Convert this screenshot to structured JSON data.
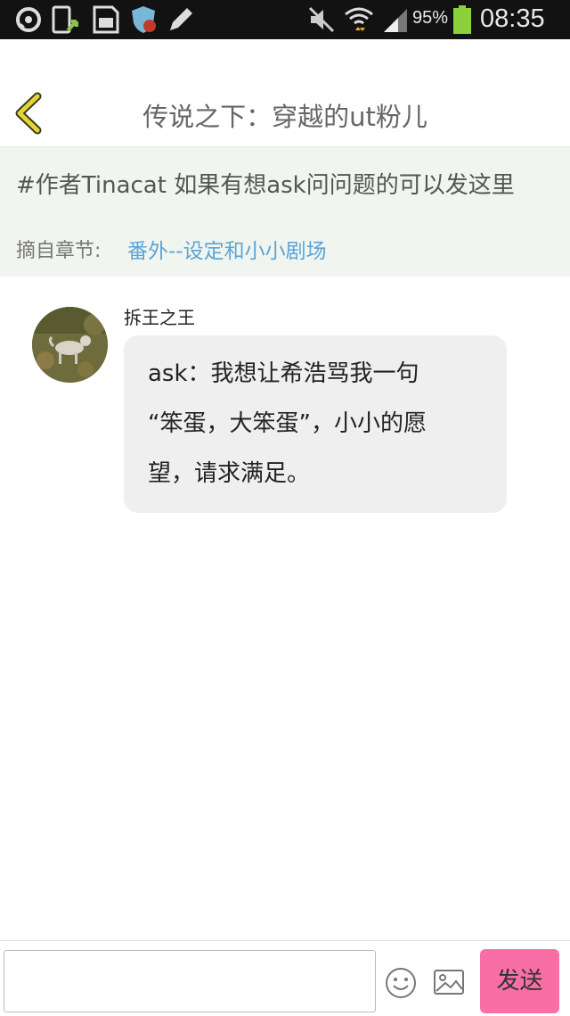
{
  "status_bar": {
    "battery_percent": "95%",
    "time": "08:35",
    "icons": [
      "chat-icon",
      "phone-sync-icon",
      "sd-card-icon",
      "shield-icon",
      "pencil-icon",
      "mute-icon",
      "wifi-icon",
      "signal-icon",
      "battery-icon"
    ]
  },
  "header": {
    "title": "传说之下：穿越的ut粉儿",
    "back_icon": "chevron-left-icon"
  },
  "topic": {
    "text": "#作者Tinacat 如果有想ask问问题的可以发这里",
    "chapter_label": "摘自章节:",
    "chapter_link": "番外--设定和小小剧场"
  },
  "message": {
    "username": "拆王之王",
    "lines": [
      "ask：我想让希浩骂我一句",
      "“笨蛋，大笨蛋”，小小的愿",
      "望，请求满足。"
    ]
  },
  "input_bar": {
    "placeholder": "",
    "send_label": "发送",
    "emoji_icon": "smiley-icon",
    "image_icon": "image-icon"
  },
  "colors": {
    "status_bar_bg": "#121212",
    "topic_bg": "#f1f5ef",
    "link": "#5aa5d9",
    "send_button": "#f86fa5",
    "bubble_bg": "#efefef",
    "back_arrow": "#e6d43a"
  }
}
